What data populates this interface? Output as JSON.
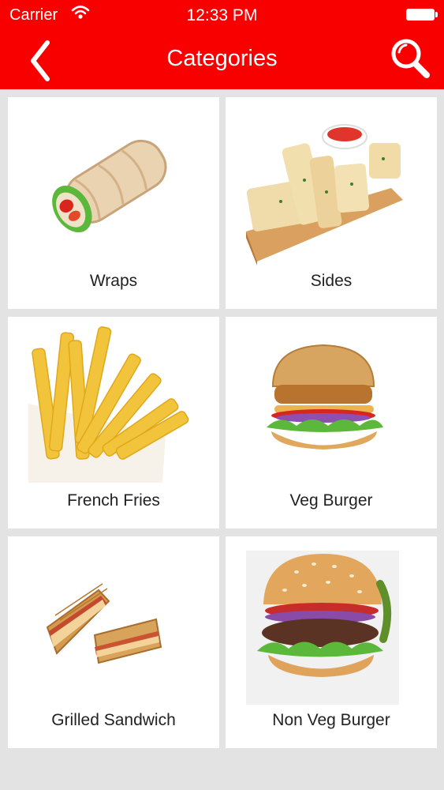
{
  "status_bar": {
    "carrier": "Carrier",
    "time": "12:33 PM"
  },
  "nav": {
    "title": "Categories",
    "back_icon": "chevron-left-icon",
    "search_icon": "search-icon"
  },
  "colors": {
    "header": "#f80000",
    "background": "#e3e3e3",
    "card": "#ffffff"
  },
  "categories": [
    {
      "label": "Wraps",
      "image": "wrap-image"
    },
    {
      "label": "Sides",
      "image": "garlic-bread-image"
    },
    {
      "label": "French Fries",
      "image": "fries-image"
    },
    {
      "label": "Veg Burger",
      "image": "veg-burger-image"
    },
    {
      "label": "Grilled Sandwich",
      "image": "sandwich-image"
    },
    {
      "label": "Non Veg Burger",
      "image": "non-veg-burger-image"
    }
  ]
}
